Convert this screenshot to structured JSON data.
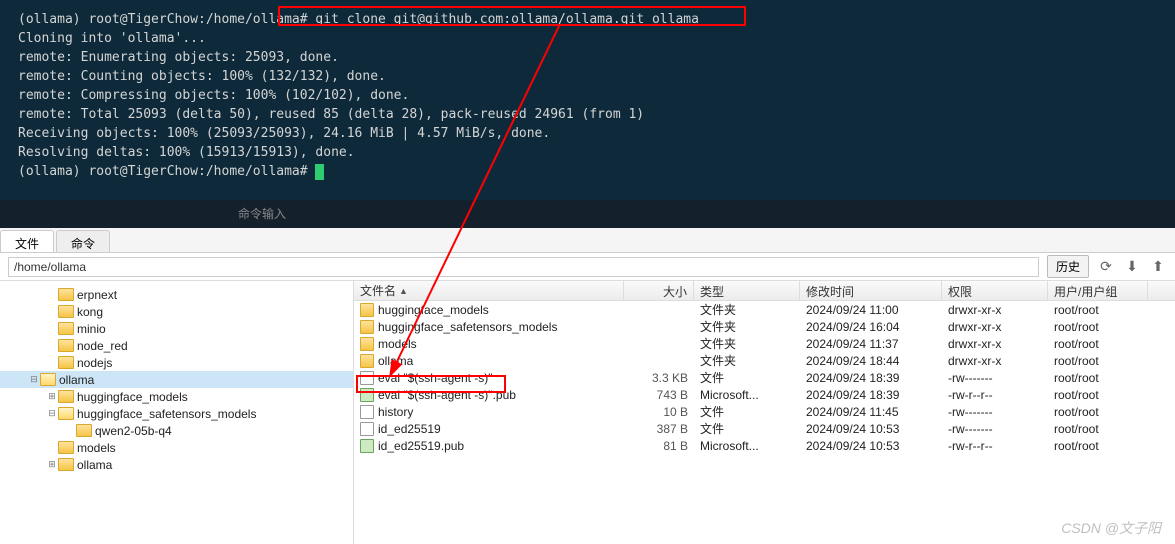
{
  "terminal": {
    "prompt1": "(ollama) root@TigerChow:/home/ollama#",
    "command": " git clone git@github.com:ollama/ollama.git ollama",
    "lines": [
      "Cloning into 'ollama'...",
      "remote: Enumerating objects: 25093, done.",
      "remote: Counting objects: 100% (132/132), done.",
      "remote: Compressing objects: 100% (102/102), done.",
      "remote: Total 25093 (delta 50), reused 85 (delta 28), pack-reused 24961 (from 1)",
      "Receiving objects: 100% (25093/25093), 24.16 MiB | 4.57 MiB/s, done.",
      "Resolving deltas: 100% (15913/15913), done."
    ],
    "prompt2": "(ollama) root@TigerChow:/home/ollama# ",
    "inputPlaceholder": "命令输入"
  },
  "tabs": {
    "file": "文件",
    "command": "命令"
  },
  "toolbar": {
    "path": "/home/ollama",
    "history": "历史"
  },
  "tree": [
    {
      "indent": 2,
      "exp": "",
      "icon": "closed",
      "label": "erpnext"
    },
    {
      "indent": 2,
      "exp": "",
      "icon": "closed",
      "label": "kong"
    },
    {
      "indent": 2,
      "exp": "",
      "icon": "closed",
      "label": "minio"
    },
    {
      "indent": 2,
      "exp": "",
      "icon": "closed",
      "label": "node_red"
    },
    {
      "indent": 2,
      "exp": "",
      "icon": "closed",
      "label": "nodejs"
    },
    {
      "indent": 1,
      "exp": "⊟",
      "icon": "open",
      "label": "ollama",
      "selected": true
    },
    {
      "indent": 2,
      "exp": "⊞",
      "icon": "closed",
      "label": "huggingface_models"
    },
    {
      "indent": 2,
      "exp": "⊟",
      "icon": "open",
      "label": "huggingface_safetensors_models"
    },
    {
      "indent": 3,
      "exp": "",
      "icon": "closed",
      "label": "qwen2-05b-q4"
    },
    {
      "indent": 2,
      "exp": "",
      "icon": "closed",
      "label": "models"
    },
    {
      "indent": 2,
      "exp": "⊞",
      "icon": "closed",
      "label": "ollama"
    }
  ],
  "fileHeader": {
    "name": "文件名",
    "size": "大小",
    "type": "类型",
    "time": "修改时间",
    "perm": "权限",
    "user": "用户/用户组"
  },
  "files": [
    {
      "icon": "folder",
      "name": "huggingface_models",
      "size": "",
      "type": "文件夹",
      "time": "2024/09/24 11:00",
      "perm": "drwxr-xr-x",
      "user": "root/root"
    },
    {
      "icon": "folder",
      "name": "huggingface_safetensors_models",
      "size": "",
      "type": "文件夹",
      "time": "2024/09/24 16:04",
      "perm": "drwxr-xr-x",
      "user": "root/root"
    },
    {
      "icon": "folder",
      "name": "models",
      "size": "",
      "type": "文件夹",
      "time": "2024/09/24 11:37",
      "perm": "drwxr-xr-x",
      "user": "root/root"
    },
    {
      "icon": "folder",
      "name": "ollama",
      "size": "",
      "type": "文件夹",
      "time": "2024/09/24 18:44",
      "perm": "drwxr-xr-x",
      "user": "root/root"
    },
    {
      "icon": "file",
      "name": "eval \"$(ssh-agent -s)\"",
      "size": "3.3 KB",
      "type": "文件",
      "time": "2024/09/24 18:39",
      "perm": "-rw-------",
      "user": "root/root"
    },
    {
      "icon": "cert",
      "name": "eval \"$(ssh-agent -s)\".pub",
      "size": "743 B",
      "type": "Microsoft...",
      "time": "2024/09/24 18:39",
      "perm": "-rw-r--r--",
      "user": "root/root"
    },
    {
      "icon": "file",
      "name": "history",
      "size": "10 B",
      "type": "文件",
      "time": "2024/09/24 11:45",
      "perm": "-rw-------",
      "user": "root/root"
    },
    {
      "icon": "file",
      "name": "id_ed25519",
      "size": "387 B",
      "type": "文件",
      "time": "2024/09/24 10:53",
      "perm": "-rw-------",
      "user": "root/root"
    },
    {
      "icon": "cert",
      "name": "id_ed25519.pub",
      "size": "81 B",
      "type": "Microsoft...",
      "time": "2024/09/24 10:53",
      "perm": "-rw-r--r--",
      "user": "root/root"
    }
  ],
  "watermark": "CSDN @文子阳"
}
